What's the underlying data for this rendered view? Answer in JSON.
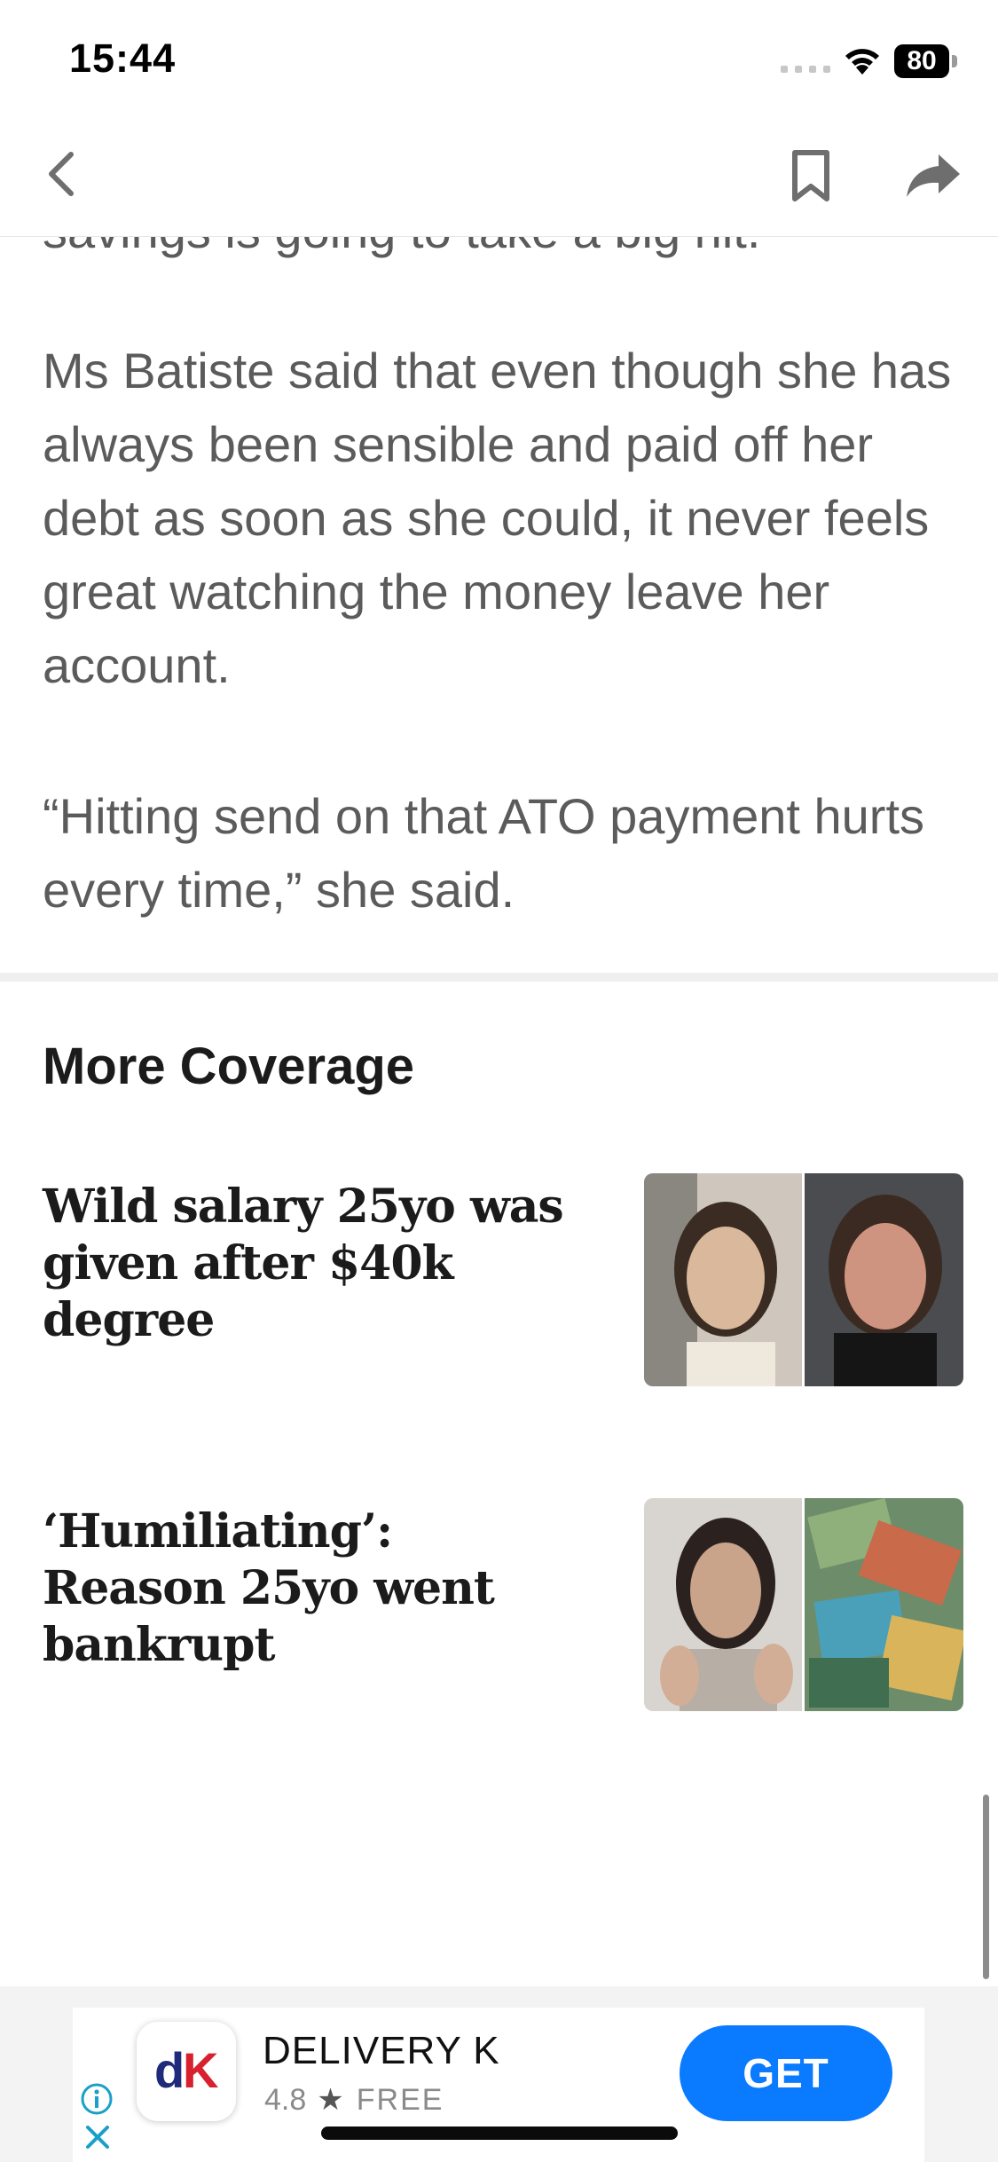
{
  "status_bar": {
    "time": "15:44",
    "battery_level": "80",
    "icons": [
      "signal-icon",
      "wifi-icon",
      "battery-icon"
    ]
  },
  "nav_bar": {
    "icons": [
      "back-chevron-icon",
      "bookmark-icon",
      "share-arrow-icon"
    ]
  },
  "article": {
    "partial_line": "savings is going to take a big hit.",
    "paragraphs": [
      "Ms Batiste said that even though she has always been sensible and paid off her debt as soon as she could, it never feels great watching the money leave her account.",
      "“Hitting send on that ATO payment hurts every time,” she said."
    ]
  },
  "more_coverage": {
    "heading": "More Coverage",
    "stories": [
      {
        "title": "Wild salary 25yo was given after $40k degree"
      },
      {
        "title": "‘Humiliating’: Reason 25yo went bankrupt"
      }
    ]
  },
  "ad": {
    "app_name": "DELIVERY K",
    "rating": "4.8",
    "price": "FREE",
    "cta": "GET",
    "logo_text": "dK",
    "icons": [
      "info-icon",
      "close-icon",
      "star-icon"
    ],
    "colors": {
      "cta": "#0a7aff",
      "logo_d": "#1f2a7a",
      "logo_k": "#d8202f"
    }
  },
  "colors": {
    "body_text": "#5b5b5b",
    "headline_text": "#1b1b1b",
    "ad_background": "#f3f3f3"
  }
}
